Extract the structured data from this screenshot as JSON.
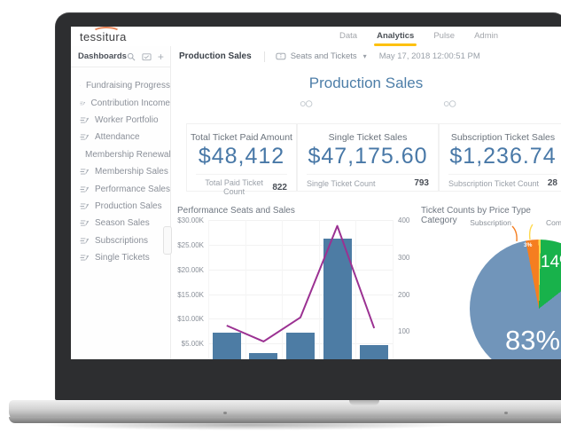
{
  "topnav": {
    "logo": "tessitura",
    "tabs": [
      {
        "label": "Data",
        "active": false
      },
      {
        "label": "Analytics",
        "active": true
      },
      {
        "label": "Pulse",
        "active": false
      },
      {
        "label": "Admin",
        "active": false
      }
    ]
  },
  "toolbar": {
    "sidebar_title": "Dashboards",
    "page_tab": "Production Sales",
    "scope_label": "Seats and Tickets",
    "timestamp": "May 17, 2018 12:00:51 PM"
  },
  "sidebar": {
    "items": [
      "Fundraising Progress",
      "Contribution Income",
      "Worker Portfolio",
      "Attendance",
      "Membership Renewals",
      "Membership Sales",
      "Performance Sales",
      "Production Sales",
      "Season Sales",
      "Subscriptions",
      "Single Tickets"
    ]
  },
  "main": {
    "title": "Production Sales",
    "kpis": [
      {
        "label": "Total Ticket Paid Amount",
        "value": "$48,412",
        "count_label": "Total Paid Ticket Count",
        "count": "822"
      },
      {
        "label": "Single Ticket Sales",
        "value": "$47,175.60",
        "count_label": "Single Ticket Count",
        "count": "793"
      },
      {
        "label": "Subscription Ticket Sales",
        "value": "$1,236.74",
        "count_label": "Subscription Ticket Count",
        "count": "28"
      }
    ]
  },
  "chart_data": [
    {
      "type": "combo-bar-line",
      "title": "Performance Seats and Sales",
      "categories": [
        "",
        "",
        "",
        "",
        ""
      ],
      "series": [
        {
          "name": "sales-bars",
          "type": "bar",
          "color": "#4d7ca4",
          "axis": "left",
          "values_usd_k": [
            7.1,
            3.0,
            7.1,
            26.2,
            4.6
          ]
        },
        {
          "name": "seats-line",
          "type": "line",
          "color": "#9b3192",
          "axis": "right",
          "values_count": [
            115,
            72,
            137,
            384,
            108
          ]
        }
      ],
      "left_axis": {
        "tick_labels": [
          "$5.00K",
          "$10.00K",
          "$15.00K",
          "$20.00K",
          "$25.00K",
          "$30.00K"
        ],
        "max_usd_k": 30
      },
      "right_axis": {
        "tick_labels": [
          "100",
          "200",
          "300",
          "400"
        ],
        "max": 400
      },
      "grid": true,
      "note": "x-axis labels hidden behind laptop bezel"
    },
    {
      "type": "pie",
      "title": "Ticket Counts by Price Type Category",
      "start_angle_deg": 349,
      "slices": [
        {
          "label": "Subscription",
          "pct": 3,
          "value_label": "3%",
          "color": "#f57e20"
        },
        {
          "label": "Comp",
          "pct": 0.5,
          "value_label": "",
          "color": "#ffd94d"
        },
        {
          "label": "",
          "pct": 14,
          "value_label": "14%",
          "color": "#18b24b"
        },
        {
          "label": "",
          "pct": 83,
          "value_label": "83%",
          "color": "#7195ba"
        }
      ],
      "legend_position": "none"
    }
  ],
  "colors": {
    "accent_yellow": "#fdc110",
    "brand_orange": "#e8865b",
    "kpi_blue": "#4878a7",
    "bar_blue": "#4d7ca4",
    "line_purple": "#9b3192"
  }
}
